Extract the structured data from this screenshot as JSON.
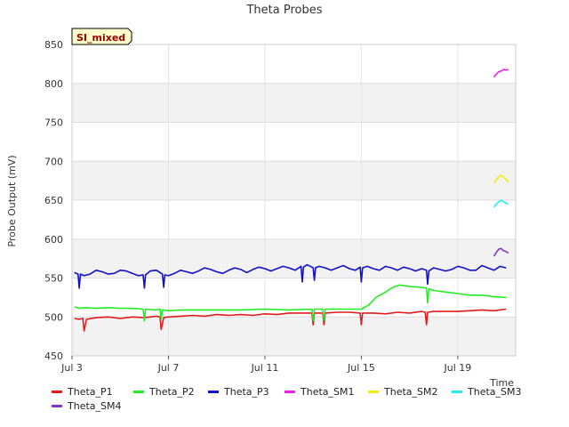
{
  "chart_data": {
    "type": "line",
    "title": "Theta Probes",
    "xlabel": "Time",
    "ylabel": "Probe Output (mV)",
    "badge": "SI_mixed",
    "xlim": [
      3.0,
      21.4
    ],
    "ylim": [
      450,
      850
    ],
    "xticks": [
      {
        "x": 3,
        "label": "Jul 3"
      },
      {
        "x": 7,
        "label": "Jul 7"
      },
      {
        "x": 11,
        "label": "Jul 11"
      },
      {
        "x": 15,
        "label": "Jul 15"
      },
      {
        "x": 19,
        "label": "Jul 19"
      }
    ],
    "yticks": [
      450,
      500,
      550,
      600,
      650,
      700,
      750,
      800,
      850
    ],
    "colors": {
      "Theta_P1": "#e41a1c",
      "Theta_P2": "#22ee22",
      "Theta_P3": "#1010cc",
      "Theta_SM1": "#ee22ee",
      "Theta_SM2": "#eeee11",
      "Theta_SM3": "#22eeee",
      "Theta_SM4": "#8833cc"
    },
    "legend": [
      "Theta_P1",
      "Theta_P2",
      "Theta_P3",
      "Theta_SM1",
      "Theta_SM2",
      "Theta_SM3",
      "Theta_SM4"
    ],
    "series": [
      {
        "name": "Theta_P1",
        "x": [
          3.1,
          3.3,
          3.45,
          3.5,
          3.6,
          4.0,
          4.5,
          5.0,
          5.5,
          6.0,
          6.5,
          6.65,
          6.7,
          6.8,
          7.0,
          7.5,
          8.0,
          8.5,
          9.0,
          9.5,
          10.0,
          10.5,
          11.0,
          11.5,
          12.0,
          12.5,
          12.95,
          13.0,
          13.05,
          13.4,
          13.45,
          13.5,
          14.0,
          14.5,
          14.95,
          15.0,
          15.05,
          15.5,
          16.0,
          16.5,
          17.0,
          17.5,
          17.65,
          17.7,
          17.75,
          18.0,
          18.5,
          19.0,
          19.5,
          20.0,
          20.5,
          21.0
        ],
        "y": [
          498,
          497,
          498,
          482,
          497,
          499,
          500,
          498,
          500,
          499,
          501,
          500,
          484,
          499,
          500,
          501,
          502,
          501,
          503,
          502,
          503,
          502,
          504,
          503,
          505,
          505,
          505,
          490,
          505,
          505,
          490,
          505,
          506,
          506,
          505,
          490,
          505,
          505,
          504,
          506,
          505,
          507,
          506,
          490,
          506,
          507,
          507,
          507,
          508,
          509,
          508,
          510
        ]
      },
      {
        "name": "Theta_P2",
        "x": [
          3.1,
          3.3,
          3.5,
          4.0,
          4.5,
          5.0,
          5.5,
          5.95,
          6.0,
          6.05,
          6.5,
          6.65,
          6.7,
          6.75,
          7.0,
          7.5,
          8.0,
          9.0,
          10.0,
          11.0,
          12.0,
          12.95,
          13.0,
          13.05,
          13.4,
          13.45,
          13.5,
          14.0,
          14.5,
          15.0,
          15.3,
          15.6,
          16.0,
          16.3,
          16.6,
          17.0,
          17.5,
          17.7,
          17.75,
          17.8,
          18.0,
          18.5,
          19.0,
          19.5,
          20.0,
          20.5,
          21.0
        ],
        "y": [
          513,
          511,
          512,
          511,
          512,
          511,
          511,
          510,
          495,
          510,
          509,
          510,
          497,
          509,
          508,
          509,
          509,
          509,
          509,
          510,
          509,
          510,
          495,
          510,
          510,
          496,
          510,
          510,
          510,
          510,
          515,
          525,
          532,
          538,
          541,
          539,
          538,
          537,
          518,
          536,
          534,
          532,
          530,
          528,
          528,
          526,
          525
        ]
      },
      {
        "name": "Theta_P3",
        "x": [
          3.1,
          3.25,
          3.3,
          3.35,
          3.5,
          3.75,
          4.0,
          4.25,
          4.5,
          4.75,
          5.0,
          5.25,
          5.5,
          5.75,
          5.95,
          6.0,
          6.05,
          6.25,
          6.5,
          6.75,
          6.8,
          6.85,
          7.0,
          7.25,
          7.5,
          7.75,
          8.0,
          8.25,
          8.5,
          8.75,
          9.0,
          9.25,
          9.5,
          9.75,
          10.0,
          10.25,
          10.5,
          10.75,
          11.0,
          11.25,
          11.5,
          11.75,
          12.0,
          12.25,
          12.5,
          12.55,
          12.6,
          12.75,
          13.0,
          13.05,
          13.1,
          13.25,
          13.5,
          13.75,
          14.0,
          14.25,
          14.5,
          14.75,
          14.95,
          15.0,
          15.05,
          15.25,
          15.5,
          15.75,
          16.0,
          16.25,
          16.5,
          16.75,
          17.0,
          17.25,
          17.5,
          17.7,
          17.75,
          17.8,
          18.0,
          18.25,
          18.5,
          18.75,
          19.0,
          19.25,
          19.5,
          19.75,
          20.0,
          20.25,
          20.5,
          20.75,
          21.0
        ],
        "y": [
          557,
          555,
          537,
          555,
          553,
          555,
          560,
          558,
          555,
          556,
          560,
          559,
          556,
          553,
          554,
          537,
          554,
          559,
          560,
          555,
          538,
          554,
          553,
          556,
          560,
          558,
          556,
          559,
          563,
          561,
          558,
          556,
          560,
          563,
          561,
          557,
          561,
          564,
          562,
          559,
          562,
          565,
          563,
          560,
          565,
          545,
          564,
          567,
          563,
          547,
          563,
          565,
          563,
          560,
          563,
          566,
          562,
          560,
          564,
          545,
          563,
          565,
          562,
          560,
          565,
          563,
          560,
          564,
          562,
          559,
          562,
          560,
          542,
          559,
          563,
          561,
          559,
          561,
          565,
          563,
          560,
          560,
          566,
          563,
          560,
          565,
          563
        ]
      },
      {
        "name": "Theta_SM1",
        "x": [
          20.5,
          20.6,
          20.7,
          20.8,
          20.9,
          21.0,
          21.1
        ],
        "y": [
          808,
          812,
          815,
          816,
          818,
          817,
          818
        ]
      },
      {
        "name": "Theta_SM2",
        "x": [
          20.5,
          20.6,
          20.7,
          20.8,
          20.9,
          21.0,
          21.1
        ],
        "y": [
          672,
          676,
          680,
          682,
          679,
          677,
          673
        ]
      },
      {
        "name": "Theta_SM3",
        "x": [
          20.5,
          20.6,
          20.7,
          20.8,
          20.9,
          21.0,
          21.1
        ],
        "y": [
          641,
          645,
          648,
          650,
          648,
          646,
          645
        ]
      },
      {
        "name": "Theta_SM4",
        "x": [
          20.5,
          20.6,
          20.7,
          20.8,
          20.9,
          21.0,
          21.1
        ],
        "y": [
          578,
          583,
          587,
          588,
          585,
          584,
          582
        ]
      }
    ]
  }
}
